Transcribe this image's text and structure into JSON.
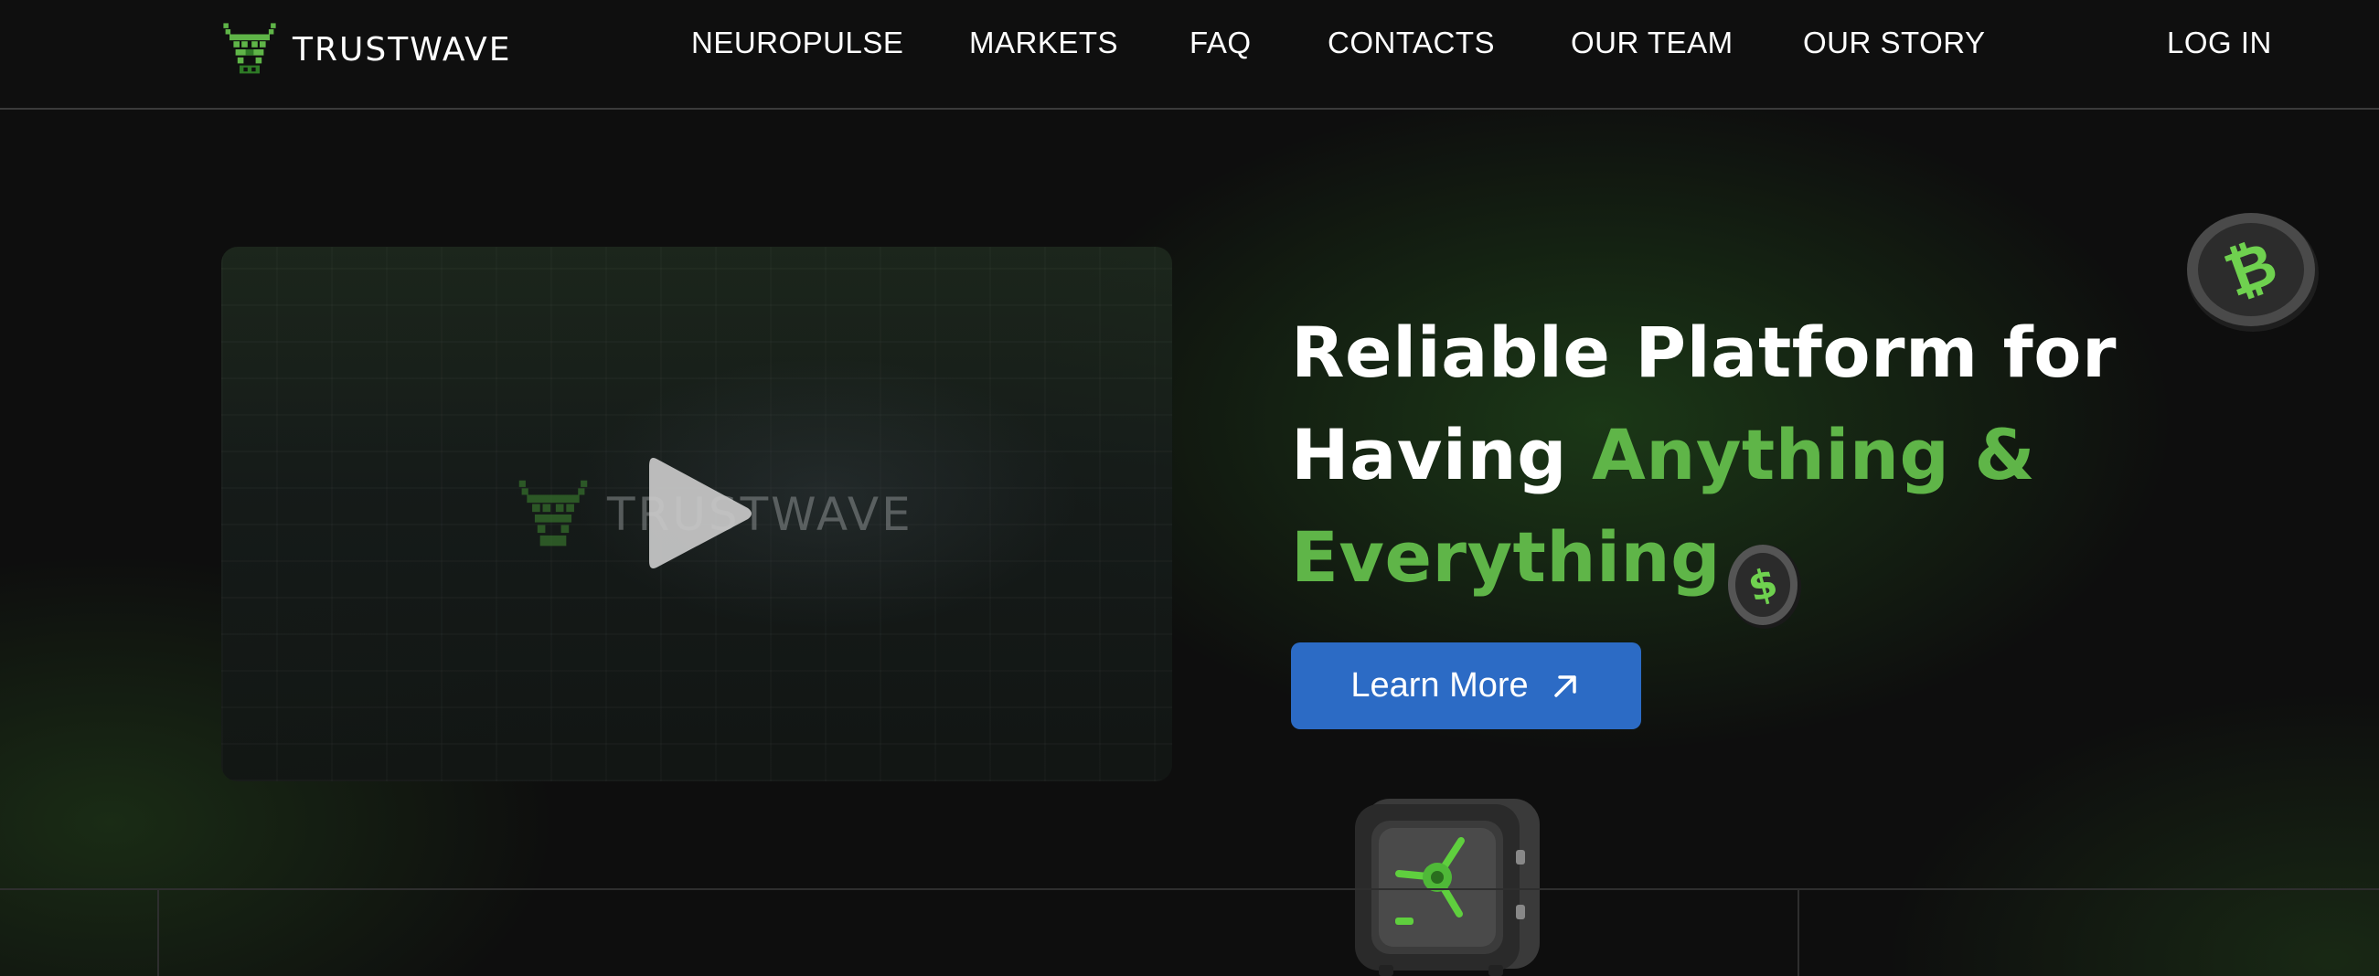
{
  "brand": {
    "name": "TRUSTWAVE",
    "accent_color": "#5fb548",
    "icon": "bull-logo-icon"
  },
  "nav": {
    "items": [
      {
        "label": "NEUROPULSE"
      },
      {
        "label": "MARKETS"
      },
      {
        "label": "FAQ"
      },
      {
        "label": "CONTACTS"
      },
      {
        "label": "OUR TEAM"
      },
      {
        "label": "OUR STORY"
      }
    ],
    "login_label": "LOG IN"
  },
  "video": {
    "watermark": "TRUSTWAVE",
    "play_icon": "play-icon"
  },
  "hero": {
    "title_line1": "Reliable Platform for",
    "title_line2_plain": "Having ",
    "title_line2_accent": "Anything &",
    "title_line3_accent": "Everything",
    "cta_label": "Learn More",
    "cta_icon": "arrow-up-right-icon",
    "cta_color": "#2c6bc5"
  },
  "decor": {
    "coin_top": "bitcoin-coin-icon",
    "coin_small": "dollar-coin-icon",
    "safe": "vault-safe-icon"
  }
}
